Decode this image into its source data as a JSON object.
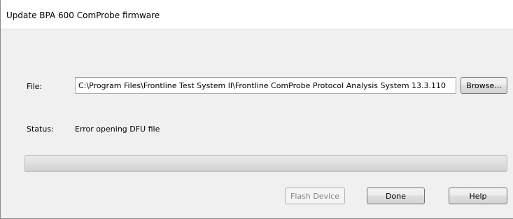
{
  "window": {
    "title": "Update BPA 600 ComProbe firmware"
  },
  "form": {
    "file_label": "File:",
    "file_value": "C:\\Program Files\\Frontline Test System II\\Frontline ComProbe Protocol Analysis System 13.3.110",
    "browse_label": "Browse...",
    "status_label": "Status:",
    "status_text": "Error opening DFU file"
  },
  "progress": {
    "value_percent": 0
  },
  "buttons": {
    "flash_label": "Flash Device",
    "flash_enabled": false,
    "done_label": "Done",
    "help_label": "Help"
  }
}
